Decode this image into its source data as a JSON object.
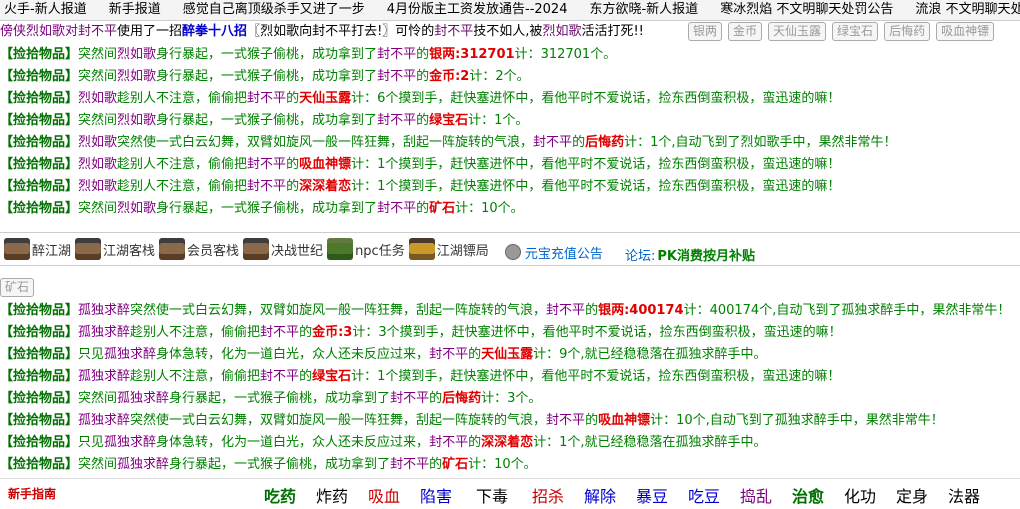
{
  "ticker": [
    "火手-新人报道",
    "新手报道",
    "感觉自己离顶级杀手又进了一步",
    "4月份版主工资发放通告--2024",
    "东方欲晓-新人报道",
    "寒冰烈焰 不文明聊天处罚公告",
    "流浪 不文明聊天处罚公告"
  ],
  "top_line": {
    "p1": "傍侠烈如歌对",
    "target": "封不平",
    "p2": "使用了一招",
    "skill": "醉拳十八招",
    "p3": "〖烈如歌向封不平打去!〗可怜的",
    "target2": "封不平",
    "p4": "技不如人,被",
    "killer": "烈如歌",
    "p5": "活活打死!!"
  },
  "item_chips": [
    "银两",
    "金币",
    "天仙玉露",
    "绿宝石",
    "后悔药",
    "吸血神镖"
  ],
  "log1": [
    {
      "tag": "【捡拾物品】",
      "a": "突然间",
      "actor": "烈如歌",
      "b": "身行暴起，一式猴子偷桃，成功拿到了",
      "victim": "封不平",
      "c": "的",
      "item": "银两:312701",
      "d": "计：312701个。"
    },
    {
      "tag": "【捡拾物品】",
      "a": "突然间",
      "actor": "烈如歌",
      "b": "身行暴起，一式猴子偷桃，成功拿到了",
      "victim": "封不平",
      "c": "的",
      "item": "金币:2",
      "d": "计：2个。"
    },
    {
      "tag": "【捡拾物品】",
      "a": "",
      "actor": "烈如歌",
      "b": "趁别人不注意，偷偷把",
      "victim": "封不平",
      "c": "的",
      "item": "天仙玉露",
      "d": "计：6个摸到手，赶快塞进怀中，看他平时不爱说话，捡东西倒蛮积极，蛮迅速的嘛！"
    },
    {
      "tag": "【捡拾物品】",
      "a": "突然间",
      "actor": "烈如歌",
      "b": "身行暴起，一式猴子偷桃，成功拿到了",
      "victim": "封不平",
      "c": "的",
      "item": "绿宝石",
      "d": "计：1个。"
    },
    {
      "tag": "【捡拾物品】",
      "a": "",
      "actor": "烈如歌",
      "b": "突然使一式白云幻舞，双臂如旋风一般一阵狂舞，刮起一阵旋转的气浪，",
      "victim": "封不平",
      "c": "的",
      "item": "后悔药",
      "d": "计：1个,自动飞到了烈如歌手中，果然非常牛！"
    },
    {
      "tag": "【捡拾物品】",
      "a": "",
      "actor": "烈如歌",
      "b": "趁别人不注意，偷偷把",
      "victim": "封不平",
      "c": "的",
      "item": "吸血神镖",
      "d": "计：1个摸到手，赶快塞进怀中，看他平时不爱说话，捡东西倒蛮积极，蛮迅速的嘛！"
    },
    {
      "tag": "【捡拾物品】",
      "a": "",
      "actor": "烈如歌",
      "b": "趁别人不注意，偷偷把",
      "victim": "封不平",
      "c": "的",
      "item": "深深着恋",
      "d": "计：1个摸到手，赶快塞进怀中，看他平时不爱说话，捡东西倒蛮积极，蛮迅速的嘛！"
    },
    {
      "tag": "【捡拾物品】",
      "a": "突然间",
      "actor": "烈如歌",
      "b": "身行暴起，一式猴子偷桃，成功拿到了",
      "victim": "封不平",
      "c": "的",
      "item": "矿石",
      "d": "计：10个。"
    }
  ],
  "nav": [
    {
      "label": "醉江湖",
      "icon": "tavern-icon",
      "style": ""
    },
    {
      "label": "江湖客栈",
      "icon": "inn-icon",
      "style": ""
    },
    {
      "label": "会员客栈",
      "icon": "member-inn-icon",
      "style": ""
    },
    {
      "label": "决战世纪",
      "icon": "battle-icon",
      "style": ""
    },
    {
      "label": "npc任务",
      "icon": "npc-quest-icon",
      "style": "green"
    },
    {
      "label": "江湖镖局",
      "icon": "escort-agency-icon",
      "style": "gold"
    }
  ],
  "recharge_label": "元宝充值公告",
  "forum_label": "论坛:",
  "pk_label": "PK消费按月补贴",
  "mine_chip": "矿石",
  "log2": [
    {
      "tag": "【捡拾物品】",
      "a": "",
      "actor": "孤独求醉",
      "b": "突然使一式白云幻舞，双臂如旋风一般一阵狂舞，刮起一阵旋转的气浪，",
      "victim": "封不平",
      "c": "的",
      "item": "银两:400174",
      "d": "计：400174个,自动飞到了孤独求醉手中，果然非常牛！"
    },
    {
      "tag": "【捡拾物品】",
      "a": "",
      "actor": "孤独求醉",
      "b": "趁别人不注意，偷偷把",
      "victim": "封不平",
      "c": "的",
      "item": "金币:3",
      "d": "计：3个摸到手，赶快塞进怀中，看他平时不爱说话，捡东西倒蛮积极，蛮迅速的嘛！"
    },
    {
      "tag": "【捡拾物品】",
      "a": "只见",
      "actor": "孤独求醉",
      "b": "身体急转，化为一道白光，众人还未反应过来，",
      "victim": "封不平",
      "c": "的",
      "item": "天仙玉露",
      "d": "计：9个,就已经稳稳落在孤独求醉手中。"
    },
    {
      "tag": "【捡拾物品】",
      "a": "",
      "actor": "孤独求醉",
      "b": "趁别人不注意，偷偷把",
      "victim": "封不平",
      "c": "的",
      "item": "绿宝石",
      "d": "计：1个摸到手，赶快塞进怀中，看他平时不爱说话，捡东西倒蛮积极，蛮迅速的嘛！"
    },
    {
      "tag": "【捡拾物品】",
      "a": "突然间",
      "actor": "孤独求醉",
      "b": "身行暴起，一式猴子偷桃，成功拿到了",
      "victim": "封不平",
      "c": "的",
      "item": "后悔药",
      "d": "计：3个。"
    },
    {
      "tag": "【捡拾物品】",
      "a": "",
      "actor": "孤独求醉",
      "b": "突然使一式白云幻舞，双臂如旋风一般一阵狂舞，刮起一阵旋转的气浪，",
      "victim": "封不平",
      "c": "的",
      "item": "吸血神镖",
      "d": "计：10个,自动飞到了孤独求醉手中，果然非常牛！"
    },
    {
      "tag": "【捡拾物品】",
      "a": "只见",
      "actor": "孤独求醉",
      "b": "身体急转，化为一道白光，众人还未反应过来，",
      "victim": "封不平",
      "c": "的",
      "item": "深深着恋",
      "d": "计：1个,就已经稳稳落在孤独求醉手中。"
    },
    {
      "tag": "【捡拾物品】",
      "a": "突然间",
      "actor": "孤独求醉",
      "b": "身行暴起，一式猴子偷桃，成功拿到了",
      "victim": "封不平",
      "c": "的",
      "item": "矿石",
      "d": "计：10个。"
    }
  ],
  "guide_label": "新手指南",
  "commands": [
    {
      "label": "吃药",
      "color": "c-green"
    },
    {
      "label": "炸药",
      "color": "c-black"
    },
    {
      "label": "吸血",
      "color": "c-red"
    },
    {
      "label": "陷害",
      "color": "c-blue"
    },
    {
      "label": "下毒",
      "color": "c-black"
    },
    {
      "label": "招杀",
      "color": "c-red"
    },
    {
      "label": "解除",
      "color": "c-blue"
    },
    {
      "label": "暴豆",
      "color": "c-blue"
    },
    {
      "label": "吃豆",
      "color": "c-blue"
    },
    {
      "label": "捣乱",
      "color": "c-purple"
    },
    {
      "label": "治愈",
      "color": "c-green"
    },
    {
      "label": "化功",
      "color": "c-black"
    },
    {
      "label": "定身",
      "color": "c-black"
    },
    {
      "label": "法器",
      "color": "c-black"
    }
  ]
}
